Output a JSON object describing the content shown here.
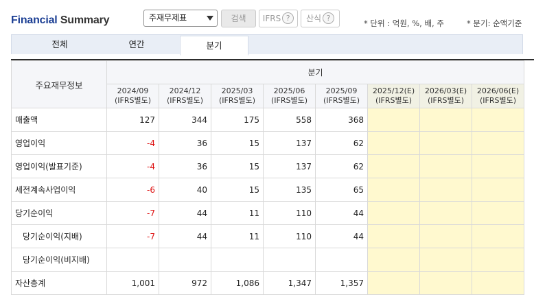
{
  "header": {
    "title_part1": "Financial",
    "title_part2": "Summary",
    "select_value": "주재무제표",
    "search_button": "검색",
    "ifrs_button": "IFRS",
    "calc_button": "산식",
    "help_symbol": "?",
    "unit_note": "* 단위 : 억원, %, 배, 주",
    "quarter_note": "* 분기: 순액기준"
  },
  "tabs": [
    {
      "label": "전체"
    },
    {
      "label": "연간"
    },
    {
      "label": "분기"
    }
  ],
  "table": {
    "row_header": "주요재무정보",
    "group_header": "분기",
    "columns": [
      {
        "period": "2024/09",
        "basis": "(IFRS별도)",
        "estimate": false
      },
      {
        "period": "2024/12",
        "basis": "(IFRS별도)",
        "estimate": false
      },
      {
        "period": "2025/03",
        "basis": "(IFRS별도)",
        "estimate": false
      },
      {
        "period": "2025/06",
        "basis": "(IFRS별도)",
        "estimate": false
      },
      {
        "period": "2025/09",
        "basis": "(IFRS별도)",
        "estimate": false
      },
      {
        "period": "2025/12(E)",
        "basis": "(IFRS별도)",
        "estimate": true
      },
      {
        "period": "2026/03(E)",
        "basis": "(IFRS별도)",
        "estimate": true
      },
      {
        "period": "2026/06(E)",
        "basis": "(IFRS별도)",
        "estimate": true
      }
    ],
    "rows": [
      {
        "label": "매출액",
        "indent": false,
        "values": [
          "127",
          "344",
          "175",
          "558",
          "368",
          "",
          "",
          ""
        ]
      },
      {
        "label": "영업이익",
        "indent": false,
        "values": [
          "-4",
          "36",
          "15",
          "137",
          "62",
          "",
          "",
          ""
        ]
      },
      {
        "label": "영업이익(발표기준)",
        "indent": false,
        "values": [
          "-4",
          "36",
          "15",
          "137",
          "62",
          "",
          "",
          ""
        ]
      },
      {
        "label": "세전계속사업이익",
        "indent": false,
        "values": [
          "-6",
          "40",
          "15",
          "135",
          "65",
          "",
          "",
          ""
        ]
      },
      {
        "label": "당기순이익",
        "indent": false,
        "values": [
          "-7",
          "44",
          "11",
          "110",
          "44",
          "",
          "",
          ""
        ]
      },
      {
        "label": "당기순이익(지배)",
        "indent": true,
        "values": [
          "-7",
          "44",
          "11",
          "110",
          "44",
          "",
          "",
          ""
        ]
      },
      {
        "label": "당기순이익(비지배)",
        "indent": true,
        "values": [
          "",
          "",
          "",
          "",
          "",
          "",
          "",
          ""
        ]
      },
      {
        "label": "자산총계",
        "indent": false,
        "values": [
          "1,001",
          "972",
          "1,086",
          "1,347",
          "1,357",
          "",
          "",
          ""
        ]
      }
    ]
  },
  "colors": {
    "title_blue": "#1c3f94",
    "negative": "#dd1111",
    "estimate_bg": "#fff9cf"
  }
}
